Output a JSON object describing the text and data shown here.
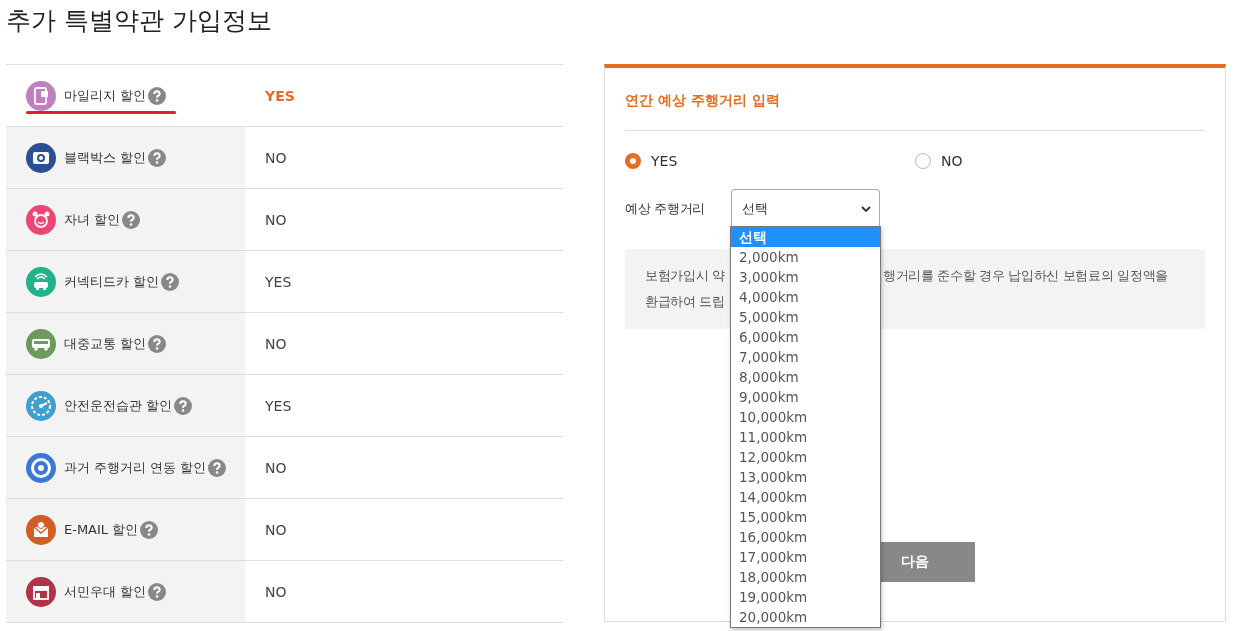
{
  "page_title": "추가 특별약관 가입정보",
  "discounts": [
    {
      "kind": "mileage",
      "label": "마일리지 할인",
      "value": "YES",
      "selected": true,
      "color": "#c27fc0"
    },
    {
      "kind": "blackbox",
      "label": "블랙박스 할인",
      "value": "NO",
      "selected": false,
      "color": "#2a4f94"
    },
    {
      "kind": "child",
      "label": "자녀 할인",
      "value": "NO",
      "selected": false,
      "color": "#ee4672"
    },
    {
      "kind": "connected",
      "label": "커넥티드카 할인",
      "value": "YES",
      "selected": false,
      "color": "#1fb389"
    },
    {
      "kind": "bus",
      "label": "대중교통 할인",
      "value": "NO",
      "selected": false,
      "color": "#6e9a5e"
    },
    {
      "kind": "speedometer",
      "label": "안전운전습관 할인",
      "value": "YES",
      "selected": false,
      "color": "#3e9fd0"
    },
    {
      "kind": "target",
      "label": "과거 주행거리 연동 할인",
      "value": "NO",
      "selected": false,
      "color": "#3a78d8"
    },
    {
      "kind": "email",
      "label": "E-MAIL 할인",
      "value": "NO",
      "selected": false,
      "color": "#d35d26"
    },
    {
      "kind": "store",
      "label": "서민우대 할인",
      "value": "NO",
      "selected": false,
      "color": "#b03348"
    }
  ],
  "panel": {
    "title": "연간 예상 주행거리 입력",
    "radios": [
      {
        "label": "YES",
        "selected": true
      },
      {
        "label": "NO",
        "selected": false
      }
    ],
    "distance_label": "예상 주행거리",
    "select_value": "선택",
    "info_lines": [
      [
        "보험가입시 약",
        "행거리를 준수할 경우 납입하신 보험료의 일정액을"
      ],
      [
        "환급하여 드립"
      ]
    ],
    "next_button": "다음",
    "options": [
      {
        "label": "선택",
        "selected": true
      },
      {
        "label": "2,000km",
        "selected": false
      },
      {
        "label": "3,000km",
        "selected": false
      },
      {
        "label": "4,000km",
        "selected": false
      },
      {
        "label": "5,000km",
        "selected": false
      },
      {
        "label": "6,000km",
        "selected": false
      },
      {
        "label": "7,000km",
        "selected": false
      },
      {
        "label": "8,000km",
        "selected": false
      },
      {
        "label": "9,000km",
        "selected": false
      },
      {
        "label": "10,000km",
        "selected": false
      },
      {
        "label": "11,000km",
        "selected": false
      },
      {
        "label": "12,000km",
        "selected": false
      },
      {
        "label": "13,000km",
        "selected": false
      },
      {
        "label": "14,000km",
        "selected": false
      },
      {
        "label": "15,000km",
        "selected": false
      },
      {
        "label": "16,000km",
        "selected": false
      },
      {
        "label": "17,000km",
        "selected": false
      },
      {
        "label": "18,000km",
        "selected": false
      },
      {
        "label": "19,000km",
        "selected": false
      },
      {
        "label": "20,000km",
        "selected": false
      }
    ]
  }
}
